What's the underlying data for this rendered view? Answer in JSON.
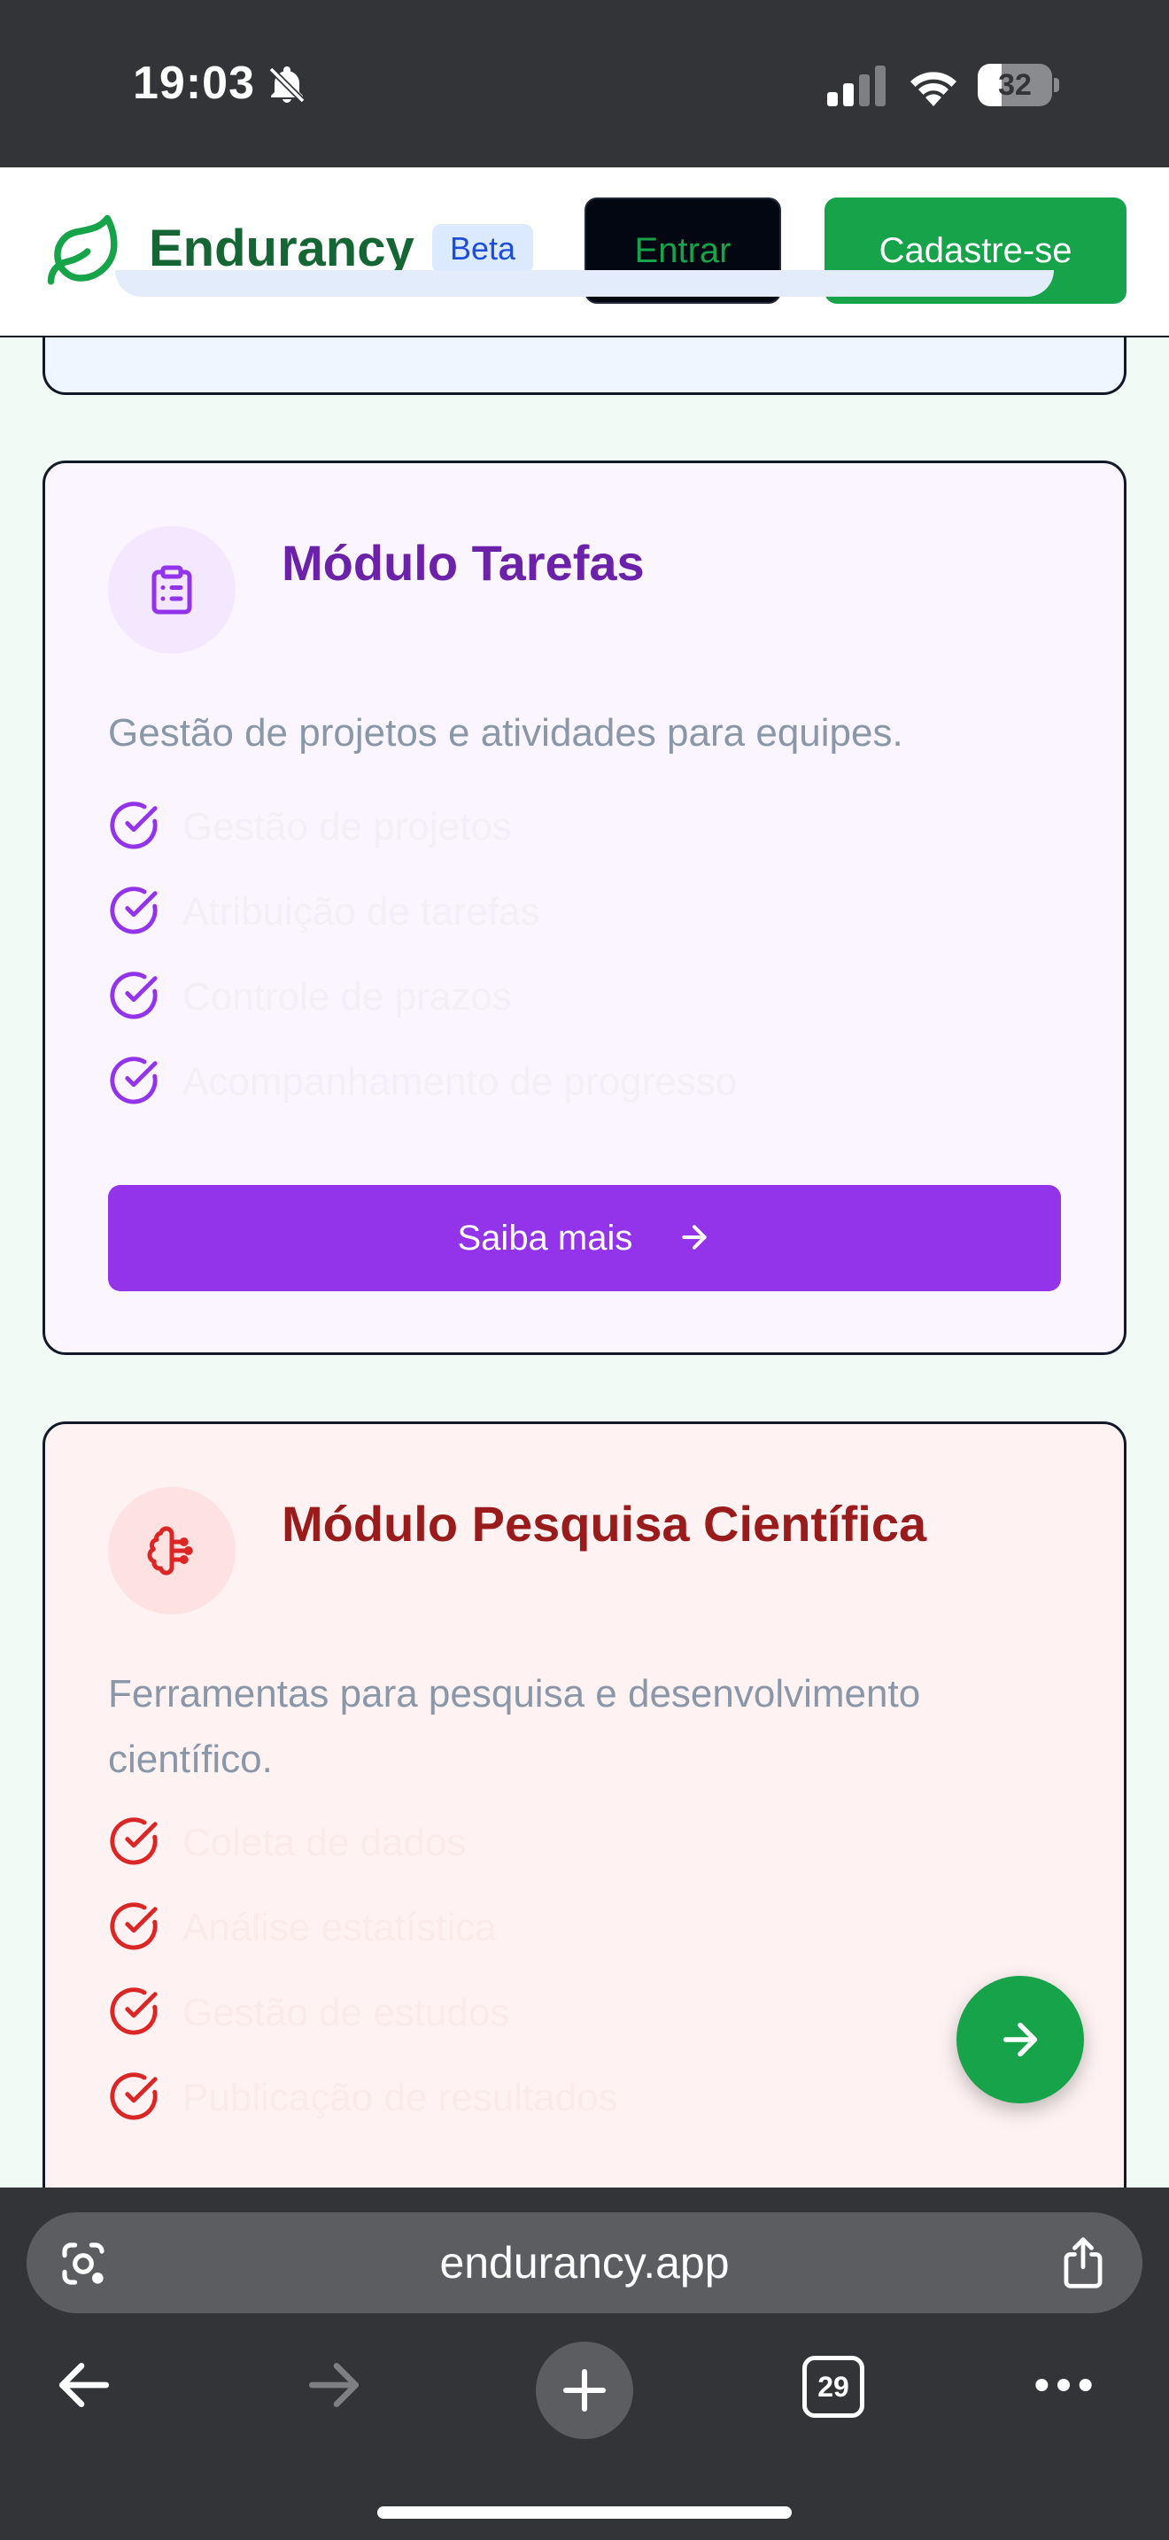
{
  "status_bar": {
    "time": "19:03",
    "battery_level": "32",
    "icons": [
      "bell-slash-icon",
      "cellular-signal-icon",
      "wifi-icon",
      "battery-icon"
    ]
  },
  "header": {
    "brand": "Endurancy",
    "badge": "Beta",
    "login_label": "Entrar",
    "signup_label": "Cadastre-se",
    "logo_icon": "leaf-icon",
    "brand_color": "#166534",
    "accent_color": "#16a34a"
  },
  "modules": [
    {
      "title": "Módulo Tarefas",
      "description": "Gestão de projetos e atividades para equipes.",
      "icon": "clipboard-list-icon",
      "accent_color": "#9333ea",
      "features": [
        "Gestão de projetos",
        "Atribuição de tarefas",
        "Controle de prazos",
        "Acompanhamento de progresso"
      ],
      "button_label": "Saiba mais"
    },
    {
      "title": "Módulo Pesquisa Científica",
      "description": "Ferramentas para pesquisa e desenvolvimento científico.",
      "icon": "brain-icon",
      "accent_color": "#dc2626",
      "features": [
        "Coleta de dados",
        "Análise estatística",
        "Gestão de estudos",
        "Publicação de resultados"
      ]
    }
  ],
  "fab": {
    "icon": "arrow-right-icon"
  },
  "browser": {
    "url": "endurancy.app",
    "tab_count": "29",
    "icons": [
      "google-lens-icon",
      "share-icon",
      "back-arrow-icon",
      "forward-arrow-icon",
      "new-tab-plus-icon",
      "tab-switcher-icon",
      "more-dots-icon"
    ]
  }
}
